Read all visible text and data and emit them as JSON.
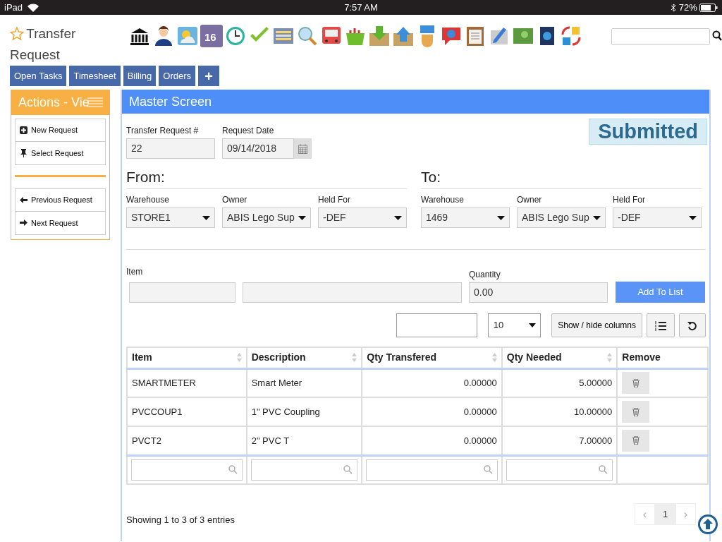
{
  "status_bar": {
    "device": "iPad",
    "time": "7:57 AM",
    "battery": "72%"
  },
  "header": {
    "title_lines": [
      "Transfer",
      "Request"
    ],
    "calendar_day": "16"
  },
  "nav_buttons": [
    {
      "label": "Open Tasks"
    },
    {
      "label": "Timesheet"
    },
    {
      "label": "Billing"
    },
    {
      "label": "Orders"
    },
    {
      "label": "+"
    }
  ],
  "actions": {
    "title": "Actions - Vie",
    "groups": [
      [
        {
          "label": "New Request",
          "kind": "plus"
        },
        {
          "label": "Select Request",
          "kind": "pin"
        }
      ],
      [
        {
          "label": "Previous Request",
          "kind": "left"
        },
        {
          "label": "Next Request",
          "kind": "right"
        }
      ]
    ]
  },
  "master": {
    "title": "Master Screen",
    "request_number": {
      "label": "Transfer Request #",
      "value": "22"
    },
    "request_date": {
      "label": "Request Date",
      "value": "09/14/2018"
    },
    "status": "Submitted",
    "from": {
      "heading": "From:",
      "fields": [
        {
          "label": "Warehouse",
          "value": "STORE1"
        },
        {
          "label": "Owner",
          "value": "ABIS Lego Sup"
        },
        {
          "label": "Held For",
          "value": "-DEF"
        }
      ]
    },
    "to": {
      "heading": "To:",
      "fields": [
        {
          "label": "Warehouse",
          "value": "1469"
        },
        {
          "label": "Owner",
          "value": "ABIS Lego Sup"
        },
        {
          "label": "Held For",
          "value": "-DEF"
        }
      ]
    },
    "item_entry": {
      "item_label": "Item",
      "quantity_label": "Quantity",
      "quantity_value": "0.00",
      "add_button": "Add To List"
    },
    "table_tools": {
      "page_size": "10",
      "show_hide": "Show / hide columns"
    },
    "table": {
      "columns": [
        {
          "label": "Item",
          "sortable": true
        },
        {
          "label": "Description",
          "sortable": true
        },
        {
          "label": "Qty Transfered",
          "sortable": true
        },
        {
          "label": "Qty Needed",
          "sortable": true
        },
        {
          "label": "Remove",
          "sortable": false
        }
      ],
      "rows": [
        {
          "item": "SMARTMETER",
          "description": "Smart Meter",
          "qty_transfered": "0.00000",
          "qty_needed": "5.00000"
        },
        {
          "item": "PVCCOUP1",
          "description": "1\" PVC Coupling",
          "qty_transfered": "0.00000",
          "qty_needed": "10.00000"
        },
        {
          "item": "PVCT2",
          "description": "2\" PVC T",
          "qty_transfered": "0.00000",
          "qty_needed": "7.00000"
        }
      ]
    },
    "info": "Showing 1 to 3 of 3 entries",
    "pagination": {
      "prev": "‹",
      "next": "›",
      "pages": [
        {
          "label": "1",
          "selected": true
        }
      ]
    }
  }
}
